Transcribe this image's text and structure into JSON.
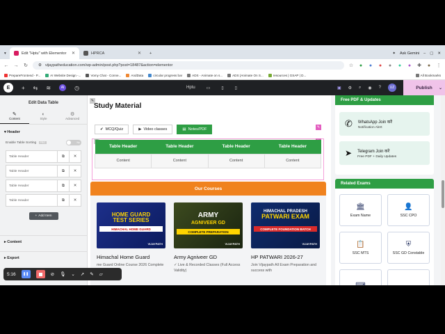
{
  "browser": {
    "tabs": [
      {
        "label": "Edit \"Hptu\" with Elementor"
      },
      {
        "label": "HPRCA"
      }
    ],
    "ask_gemini": "Ask Gemini",
    "url": "vijaypatheducation.com/wp-admin/post.php?post=18487&action=elementor",
    "bookmarks": [
      "PrepareFrontend - P...",
      "AI Website Design -...",
      "Vomy Chat - Conne...",
      "AndData",
      "circular progress bar",
      "ADS - Animate on s...",
      "ADS (Animate On S...",
      "resources | GSAP | D...",
      "All Bookmarks"
    ]
  },
  "editor": {
    "page_label": "Hptu",
    "publish_label": "Publish",
    "user_initials": "UZ"
  },
  "panel": {
    "title": "Edit Data Table",
    "tabs": [
      {
        "label": "Content",
        "icon": "pencil-icon"
      },
      {
        "label": "Style",
        "icon": "half-circle-icon"
      },
      {
        "label": "Advanced",
        "icon": "gear-icon"
      }
    ],
    "section_header": "Header",
    "enable_sorting_label": "Enable Table Sorting",
    "enable_sorting_badge": "PRO",
    "toggle_label": "No",
    "items": [
      "Table Header",
      "Table Header",
      "Table Header",
      "Table Header"
    ],
    "add_item": "Add Item",
    "section_content": "Content",
    "section_export": "Export"
  },
  "recorder": {
    "time": "5:16"
  },
  "canvas": {
    "heading": "Study Material",
    "buttons": [
      {
        "label": "MCQ/Quiz"
      },
      {
        "label": "Video classes"
      },
      {
        "label": "Notes/PDF"
      }
    ],
    "table_headers": [
      "Table Header",
      "Table Header",
      "Table Header",
      "Table Header"
    ],
    "table_cells": [
      "Content",
      "Content",
      "Content",
      "Content"
    ],
    "our_courses": "Our Courses",
    "courses": [
      {
        "image_title_top": "HOME GUARD",
        "image_title_bottom": "TEST SERIES",
        "image_band": "HIMACHAL HOME GUARD",
        "image_brand": "VIJAYPATH",
        "name": "Himachal Home Guard",
        "desc": "me Guard Online Course 2026 Complete"
      },
      {
        "image_title_top": "ARMY",
        "image_title_bottom": "AGNIVEER GD",
        "image_band": "COMPLETE PREPARATION",
        "image_brand": "VIJAYPATH",
        "name": "Army Agniveer GD",
        "desc": "✓ Live & Recorded Classes (Full Access Validity)"
      },
      {
        "image_title_top": "HIMACHAL PRADESH",
        "image_title_bottom": "PATWARI EXAM",
        "image_band": "COMPLETE FOUNDATION BATCH",
        "image_brand": "VIJAYPATH",
        "name": "HP PATWARI 2026-27",
        "desc": "Join Vijaypath All Exam Preparation and success with"
      }
    ]
  },
  "sidebar": {
    "free_pdf_head": "Free PDF & Updates",
    "whatsapp_title": "WhatsApp Join करें",
    "whatsapp_sub": "Notification Alert",
    "telegram_title": "Telegram Join करें",
    "telegram_sub": "Free PDF + Daily Updates",
    "related_head": "Related Exams",
    "exams": [
      "Exam Name",
      "SSC CPO",
      "SSC MTS",
      "SSC GD Constable"
    ]
  },
  "colors": {
    "green": "#2e9e44",
    "orange": "#f0821e",
    "publish": "#f0c3e9",
    "elementor_bar": "#1f2124"
  }
}
